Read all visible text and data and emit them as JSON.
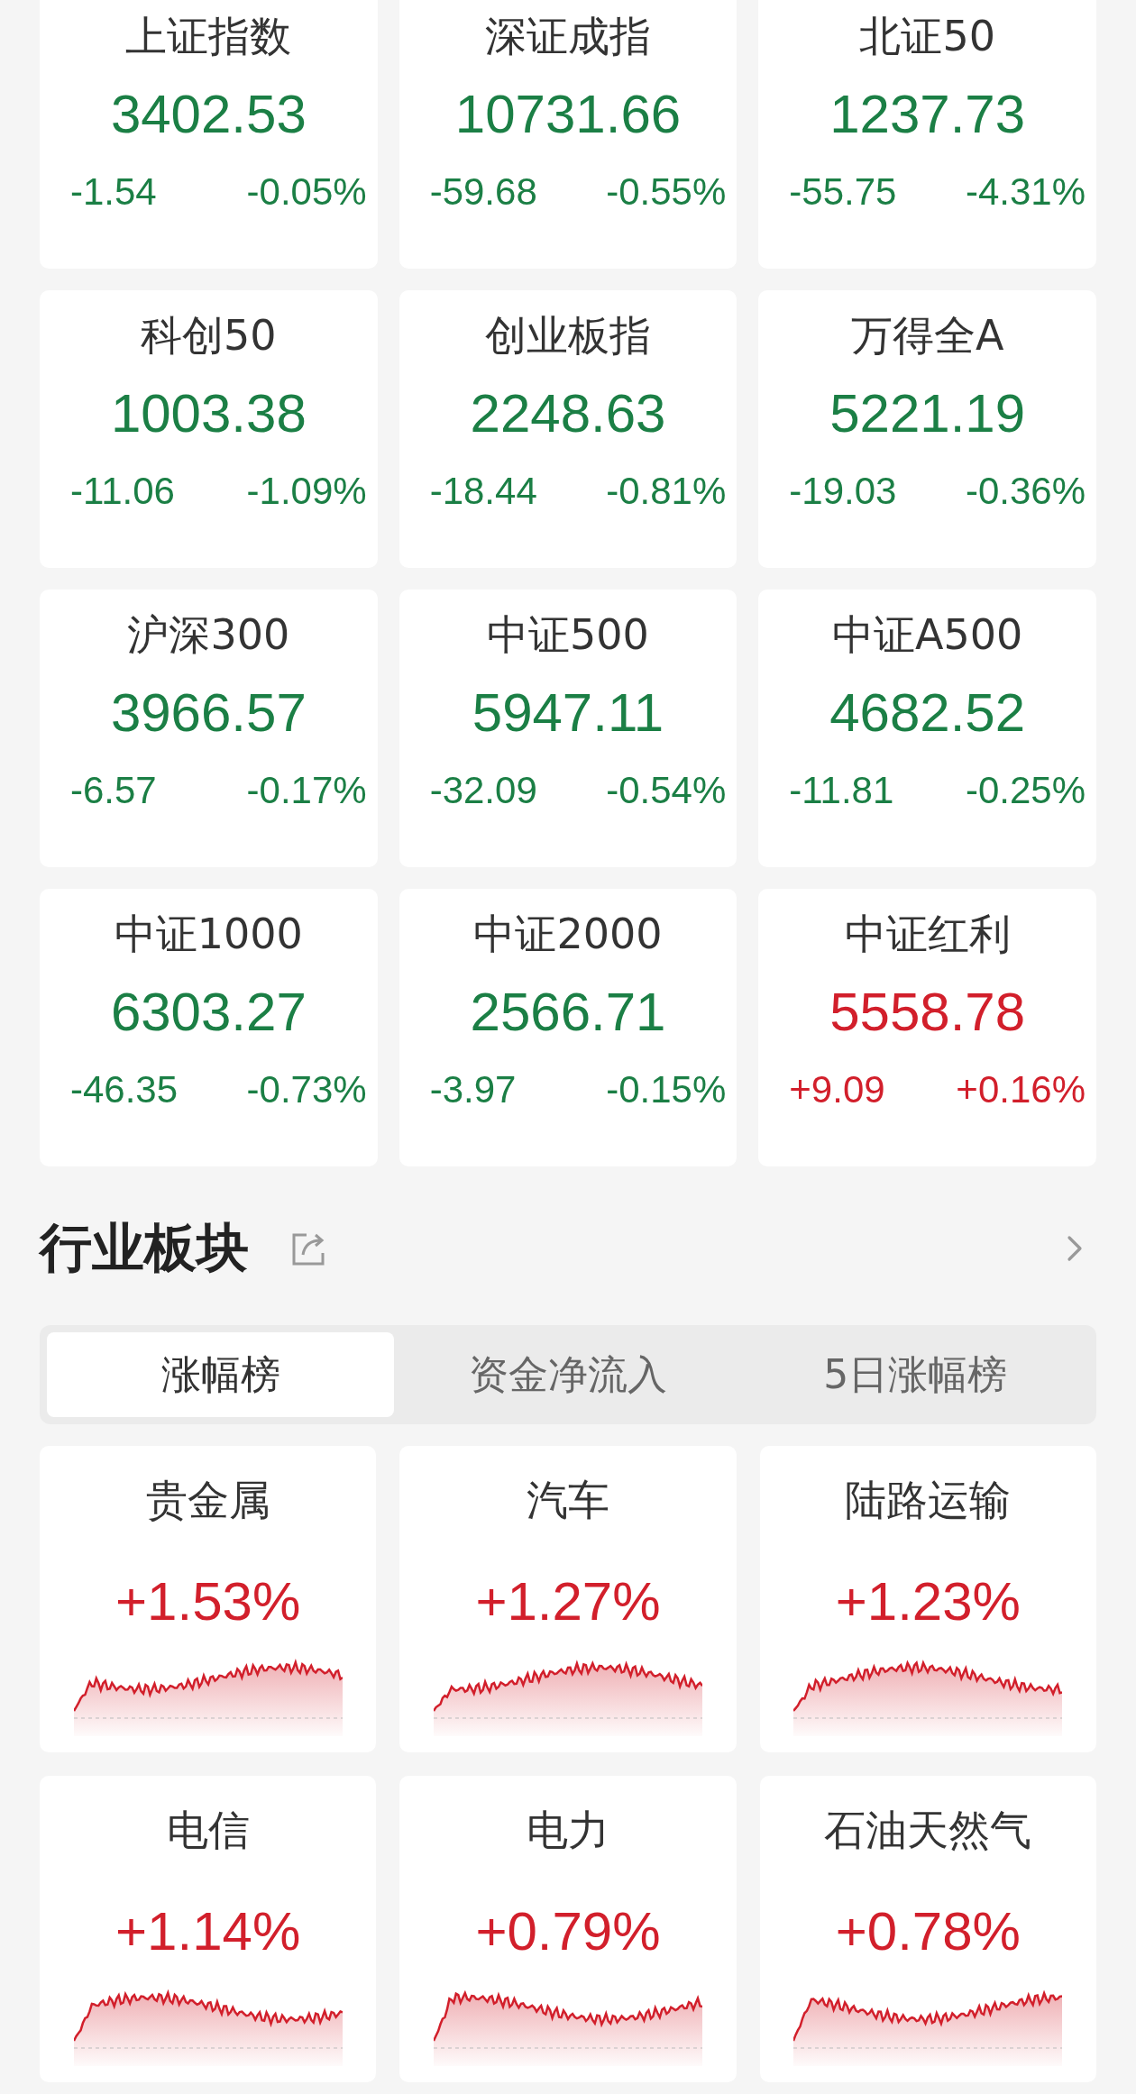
{
  "indices": [
    {
      "name": "上证指数",
      "value": "3402.53",
      "change": "-1.54",
      "percent": "-0.05%",
      "color": "#1b7f45"
    },
    {
      "name": "深证成指",
      "value": "10731.66",
      "change": "-59.68",
      "percent": "-0.55%",
      "color": "#1b7f45"
    },
    {
      "name": "北证50",
      "value": "1237.73",
      "change": "-55.75",
      "percent": "-4.31%",
      "color": "#1b7f45"
    },
    {
      "name": "科创50",
      "value": "1003.38",
      "change": "-11.06",
      "percent": "-1.09%",
      "color": "#1b7f45"
    },
    {
      "name": "创业板指",
      "value": "2248.63",
      "change": "-18.44",
      "percent": "-0.81%",
      "color": "#1b7f45"
    },
    {
      "name": "万得全A",
      "value": "5221.19",
      "change": "-19.03",
      "percent": "-0.36%",
      "color": "#1b7f45"
    },
    {
      "name": "沪深300",
      "value": "3966.57",
      "change": "-6.57",
      "percent": "-0.17%",
      "color": "#1b7f45"
    },
    {
      "name": "中证500",
      "value": "5947.11",
      "change": "-32.09",
      "percent": "-0.54%",
      "color": "#1b7f45"
    },
    {
      "name": "中证A500",
      "value": "4682.52",
      "change": "-11.81",
      "percent": "-0.25%",
      "color": "#1b7f45"
    },
    {
      "name": "中证1000",
      "value": "6303.27",
      "change": "-46.35",
      "percent": "-0.73%",
      "color": "#1b7f45"
    },
    {
      "name": "中证2000",
      "value": "2566.71",
      "change": "-3.97",
      "percent": "-0.15%",
      "color": "#1b7f45"
    },
    {
      "name": "中证红利",
      "value": "5558.78",
      "change": "+9.09",
      "percent": "+0.16%",
      "color": "#d21f2b"
    }
  ],
  "sector": {
    "title": "行业板块",
    "tabs": [
      {
        "label": "涨幅榜",
        "selected": true
      },
      {
        "label": "资金净流入",
        "selected": false
      },
      {
        "label": "5日涨幅榜",
        "selected": false
      }
    ],
    "items": [
      {
        "name": "贵金属",
        "percent": "+1.53%",
        "color": "#d21f2b"
      },
      {
        "name": "汽车",
        "percent": "+1.27%",
        "color": "#d21f2b"
      },
      {
        "name": "陆路运输",
        "percent": "+1.23%",
        "color": "#d21f2b"
      },
      {
        "name": "电信",
        "percent": "+1.14%",
        "color": "#d21f2b"
      },
      {
        "name": "电力",
        "percent": "+0.79%",
        "color": "#d21f2b"
      },
      {
        "name": "石油天然气",
        "percent": "+0.78%",
        "color": "#d21f2b"
      }
    ]
  }
}
